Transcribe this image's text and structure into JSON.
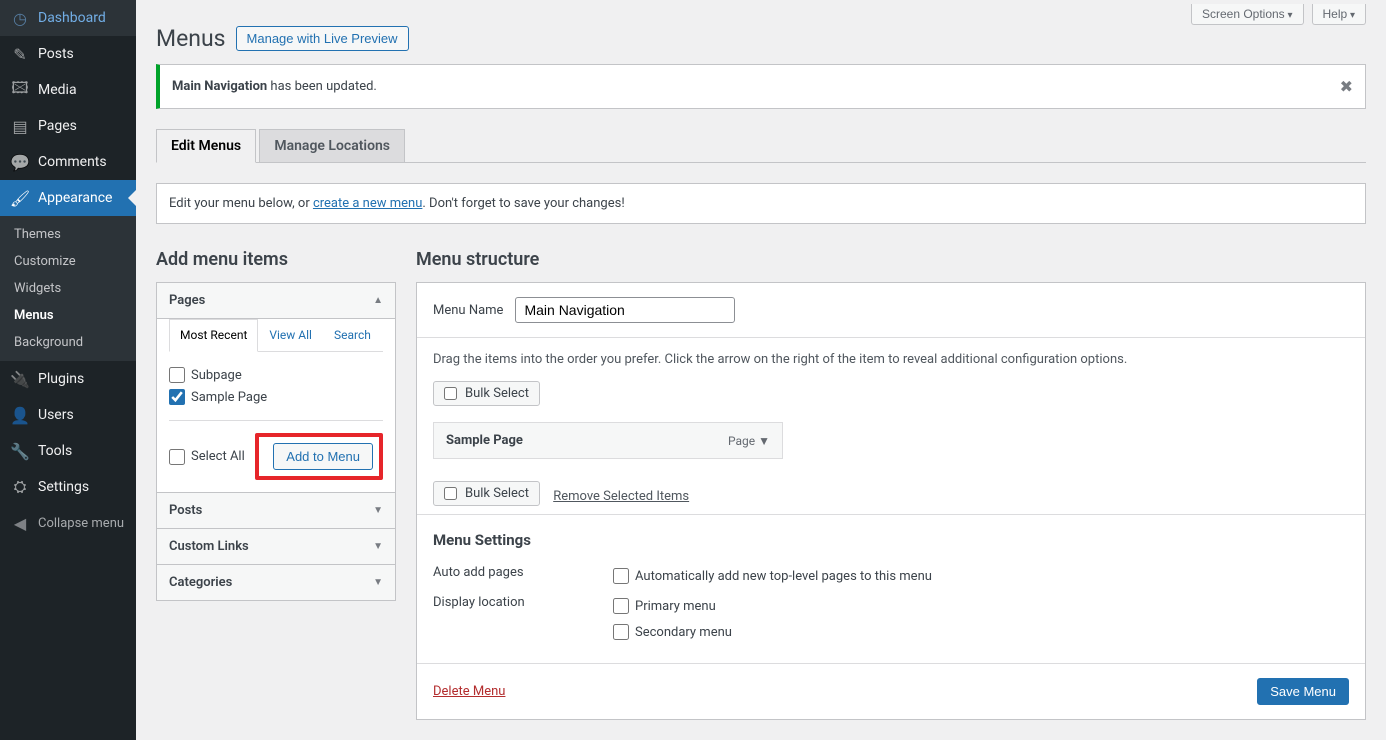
{
  "sidebar": {
    "items": [
      {
        "label": "Dashboard",
        "icon": "◷"
      },
      {
        "label": "Posts",
        "icon": "✎"
      },
      {
        "label": "Media",
        "icon": "🖾"
      },
      {
        "label": "Pages",
        "icon": "▤"
      },
      {
        "label": "Comments",
        "icon": "💬"
      },
      {
        "label": "Appearance",
        "icon": "🖌"
      },
      {
        "label": "Plugins",
        "icon": "🔌"
      },
      {
        "label": "Users",
        "icon": "👤"
      },
      {
        "label": "Tools",
        "icon": "🔧"
      },
      {
        "label": "Settings",
        "icon": "⛭"
      }
    ],
    "submenu": [
      "Themes",
      "Customize",
      "Widgets",
      "Menus",
      "Background"
    ],
    "collapse": "Collapse menu"
  },
  "topbar": {
    "screen_options": "Screen Options",
    "help": "Help"
  },
  "header": {
    "title": "Menus",
    "preview_btn": "Manage with Live Preview"
  },
  "notice": {
    "strong": "Main Navigation",
    "rest": " has been updated."
  },
  "tabs": {
    "edit": "Edit Menus",
    "locations": "Manage Locations"
  },
  "instruction": {
    "before": "Edit your menu below, or ",
    "link": "create a new menu",
    "after": ". Don't forget to save your changes!"
  },
  "add_items": {
    "title": "Add menu items",
    "pages": {
      "header": "Pages",
      "tabs": [
        "Most Recent",
        "View All",
        "Search"
      ],
      "items": [
        {
          "label": "Subpage",
          "checked": false
        },
        {
          "label": "Sample Page",
          "checked": true
        }
      ],
      "select_all": "Select All",
      "add_btn": "Add to Menu"
    },
    "other": [
      "Posts",
      "Custom Links",
      "Categories"
    ]
  },
  "structure": {
    "title": "Menu structure",
    "name_label": "Menu Name",
    "name_value": "Main Navigation",
    "drag_text": "Drag the items into the order you prefer. Click the arrow on the right of the item to reveal additional configuration options.",
    "bulk": "Bulk Select",
    "remove": "Remove Selected Items",
    "item": {
      "title": "Sample Page",
      "type": "Page"
    },
    "settings": {
      "title": "Menu Settings",
      "auto_label": "Auto add pages",
      "auto_opt": "Automatically add new top-level pages to this menu",
      "loc_label": "Display location",
      "loc_opts": [
        "Primary menu",
        "Secondary menu"
      ]
    },
    "delete": "Delete Menu",
    "save": "Save Menu"
  }
}
